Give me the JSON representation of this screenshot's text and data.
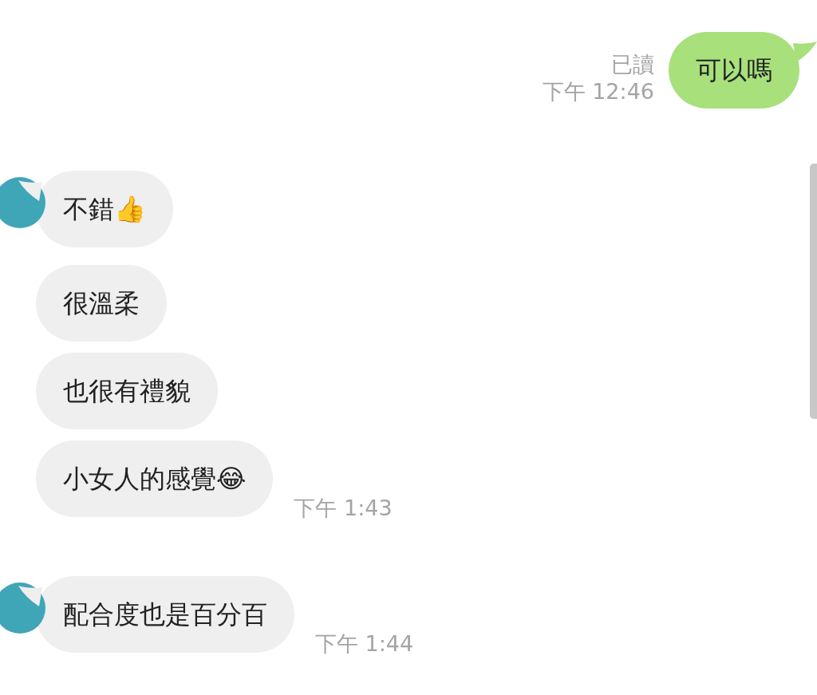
{
  "messages": [
    {
      "kind": "outgoing",
      "text": "可以嗎",
      "read": "已讀",
      "time": "下午 12:46",
      "tail": true
    },
    {
      "kind": "incoming",
      "text": "不錯👍",
      "tail": true
    },
    {
      "kind": "incoming",
      "text": "很溫柔",
      "tail": false
    },
    {
      "kind": "incoming",
      "text": "也很有禮貌",
      "tail": false
    },
    {
      "kind": "incoming",
      "text": "小女人的感覺😂",
      "time": "下午 1:43",
      "tail": false
    },
    {
      "kind": "incoming",
      "text": "配合度也是百分百",
      "time": "下午 1:44",
      "tail": true
    }
  ]
}
